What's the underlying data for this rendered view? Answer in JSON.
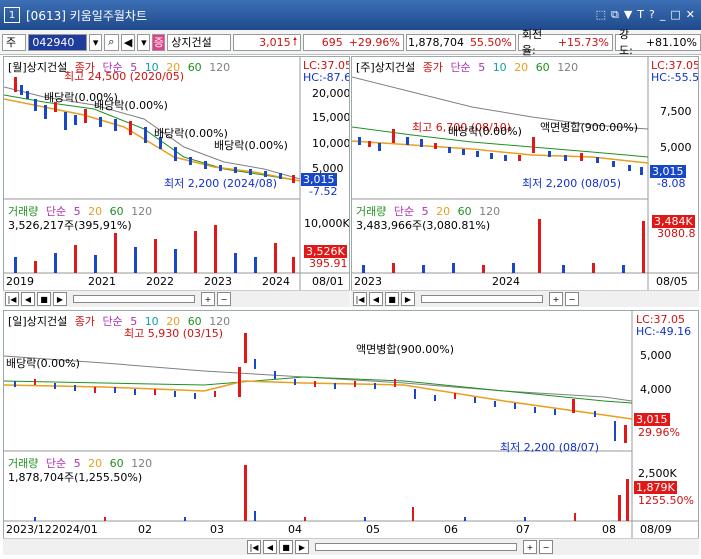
{
  "window": {
    "number": "1",
    "title": "[0613] 키움일주월차트",
    "controls": [
      "⬚",
      "⧉",
      "▼",
      "T",
      "?",
      "_",
      "□",
      "✕"
    ]
  },
  "toolbar": {
    "period_select": "주",
    "stock_code": "042940",
    "stock_name": "상지건설",
    "price": "3,015",
    "change": "695",
    "change_rate": "+29.96%",
    "volume": "1,878,704",
    "volume_rate": "55.50%",
    "turnover_label": "회전율:",
    "turnover": "+15.73%",
    "strength_label": "강도:",
    "strength": "+81.10%"
  },
  "charts": {
    "monthly": {
      "title": "[월]상지건설",
      "legend": [
        "종가",
        "단순",
        "5",
        "10",
        "20",
        "60",
        "120"
      ],
      "lc": "LC:37.05",
      "hc": "HC:-87.6",
      "y_ticks": [
        "20,000",
        "15,000",
        "10,000",
        "5,000"
      ],
      "annotations": [
        "최고 24,500 (2020/05)",
        "배당락(0.00%)",
        "배당락(0.00%)",
        "배당락(0.00%)",
        "배당락(0.00%)",
        "최저 2,200 (2024/08)"
      ],
      "price_tag": "3,015",
      "price_sub": "-7.52",
      "vol_legend": [
        "거래량",
        "단순",
        "5",
        "20",
        "60",
        "120"
      ],
      "vol_text": "3,526,217주(395,91%)",
      "vol_tick": "10,000K",
      "vol_tag": "3,526K",
      "vol_sub": "395.91",
      "x_labels": [
        "2019",
        "2021",
        "2022",
        "2023",
        "2024",
        "08/01"
      ]
    },
    "weekly": {
      "title": "[주]상지건설",
      "legend": [
        "종가",
        "단순",
        "5",
        "10",
        "20",
        "60",
        "120"
      ],
      "lc": "LC:37.05",
      "hc": "HC:-55.5",
      "y_ticks": [
        "7,500",
        "5,000"
      ],
      "annotations": [
        "최고 6,700 (08/10)",
        "배당락(0.00%)",
        "액면병합(900.00%)",
        "최저 2,200 (08/05)"
      ],
      "price_tag": "3,015",
      "price_sub": "-8.08",
      "vol_legend": [
        "거래량",
        "단순",
        "5",
        "20",
        "60",
        "120"
      ],
      "vol_text": "3,483,966주(3,080.81%)",
      "vol_tag": "3,484K",
      "vol_sub": "3080.8",
      "x_labels": [
        "2023",
        "2024",
        "08/05"
      ]
    },
    "daily": {
      "title": "[일]상지건설",
      "legend": [
        "종가",
        "단순",
        "5",
        "10",
        "20",
        "60",
        "120"
      ],
      "lc": "LC:37.05",
      "hc": "HC:-49.16",
      "y_ticks": [
        "5,000",
        "4,000",
        "3,000"
      ],
      "annotations": [
        "최고 5,930 (03/15)",
        "배당락(0.00%)",
        "액면병합(900.00%)",
        "최저 2,200 (08/07)"
      ],
      "price_tag": "3,015",
      "price_sub": "29.96%",
      "vol_legend": [
        "거래량",
        "단순",
        "5",
        "20",
        "60",
        "120"
      ],
      "vol_text": "1,878,704주(1,255.50%)",
      "vol_tick": "2,500K",
      "vol_tag": "1,879K",
      "vol_sub": "1255.50%",
      "x_labels": [
        "2023/12",
        "2024/01",
        "02",
        "03",
        "04",
        "05",
        "06",
        "07",
        "08",
        "08/09"
      ]
    }
  },
  "colors": {
    "up": "#e01818",
    "down": "#1848c8",
    "ma5": "#b030b0",
    "ma10": "#10a0a0",
    "ma20": "#e8a020",
    "ma60": "#209020",
    "ma120": "#808080"
  }
}
